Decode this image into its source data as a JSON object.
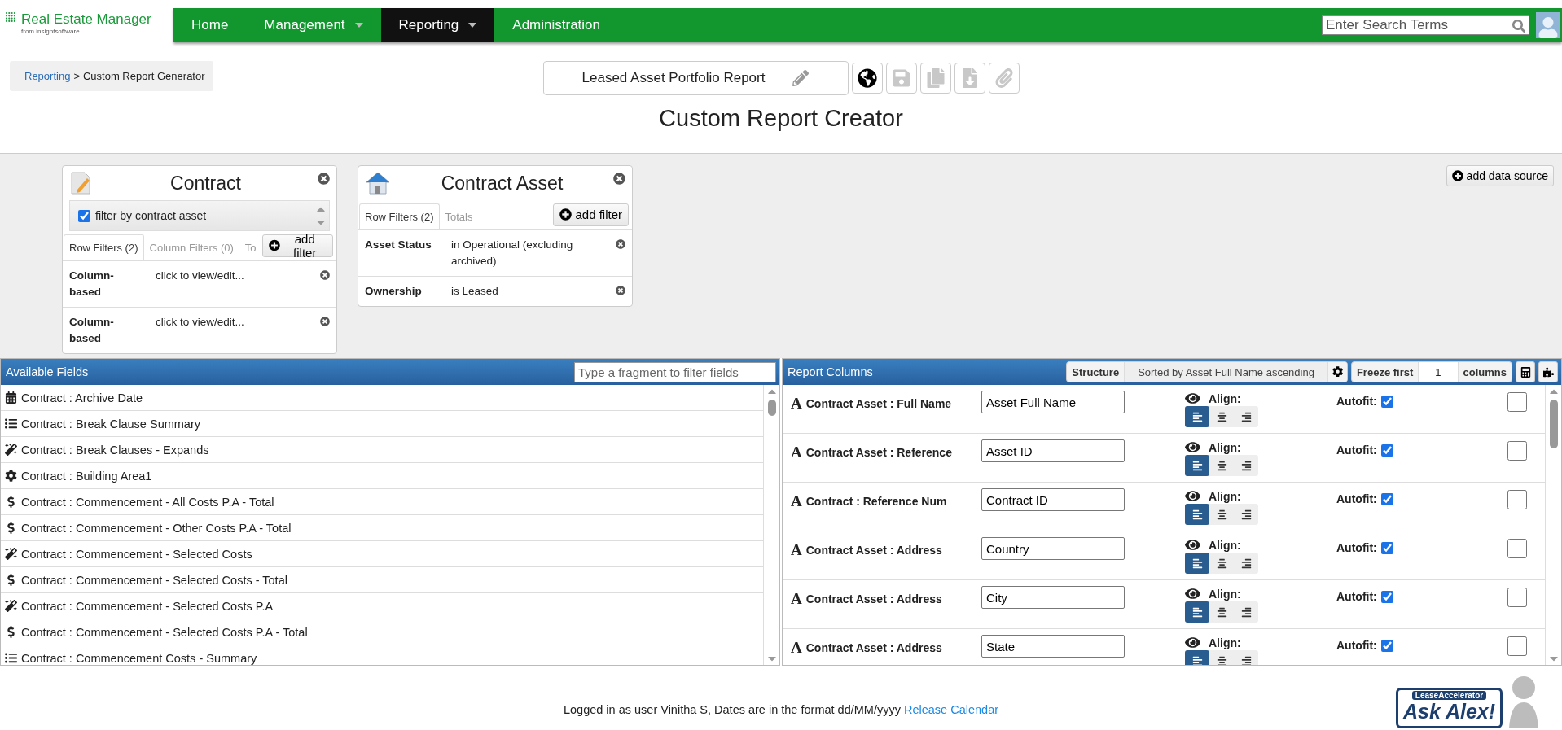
{
  "logo": {
    "title": "Real Estate Manager",
    "subtitle": "from insightsoftware"
  },
  "nav": [
    {
      "label": "Home",
      "selected": false,
      "has_menu": false
    },
    {
      "label": "Management",
      "selected": false,
      "has_menu": true
    },
    {
      "label": "Reporting",
      "selected": true,
      "has_menu": true
    },
    {
      "label": "Administration",
      "selected": false,
      "has_menu": false
    }
  ],
  "search": {
    "placeholder": "Enter Search Terms"
  },
  "breadcrumb": {
    "link": "Reporting",
    "separator": ">",
    "current": "Custom Report Generator"
  },
  "report_name": "Leased Asset Portfolio Report",
  "toolbar": [
    {
      "kind": "globe",
      "disabled": false
    },
    {
      "kind": "save",
      "disabled": true
    },
    {
      "kind": "copy",
      "disabled": true
    },
    {
      "kind": "download",
      "disabled": true
    },
    {
      "kind": "attach",
      "disabled": true
    }
  ],
  "title": "Custom Report Creator",
  "add_data_source": "add data source",
  "sources": [
    {
      "kind": "document",
      "title": "Contract",
      "option": {
        "label": "filter by contract asset",
        "checked": true
      },
      "tabs": [
        {
          "label": "Row Filters (2)",
          "selected": true
        },
        {
          "label": "Column Filters (0)",
          "selected": false
        },
        {
          "label": "To",
          "selected": false
        }
      ],
      "add_filter": "add filter",
      "filters": [
        {
          "field": "Column-based",
          "value": "click to view/edit..."
        },
        {
          "field": "Column-based",
          "value": "click to view/edit..."
        }
      ]
    },
    {
      "kind": "house",
      "title": "Contract Asset",
      "tabs": [
        {
          "label": "Row Filters (2)",
          "selected": true
        },
        {
          "label": "Totals",
          "selected": false
        }
      ],
      "add_filter": "add filter",
      "filters": [
        {
          "field": "Asset Status",
          "value": "in Operational (excluding archived)"
        },
        {
          "field": "Ownership",
          "value": "is Leased"
        }
      ]
    }
  ],
  "available_fields": {
    "title": "Available Fields",
    "placeholder": "Type a fragment to filter fields",
    "items": [
      {
        "kind": "date",
        "label": "Contract : Archive Date"
      },
      {
        "kind": "list",
        "label": "Contract : Break Clause Summary"
      },
      {
        "kind": "calc",
        "label": "Contract : Break Clauses - Expands"
      },
      {
        "kind": "custom",
        "label": "Contract : Building Area1"
      },
      {
        "kind": "money",
        "label": "Contract : Commencement - All Costs P.A - Total"
      },
      {
        "kind": "money",
        "label": "Contract : Commencement - Other Costs P.A - Total"
      },
      {
        "kind": "calc",
        "label": "Contract : Commencement - Selected Costs"
      },
      {
        "kind": "money",
        "label": "Contract : Commencement - Selected Costs - Total"
      },
      {
        "kind": "calc",
        "label": "Contract : Commencement - Selected Costs P.A"
      },
      {
        "kind": "money",
        "label": "Contract : Commencement - Selected Costs P.A - Total"
      },
      {
        "kind": "list",
        "label": "Contract : Commencement Costs - Summary"
      }
    ]
  },
  "report_columns": {
    "title": "Report Columns",
    "structure_label": "Structure",
    "structure_value": "Sorted by Asset Full Name ascending",
    "freeze_label": "Freeze first",
    "freeze_value": "1",
    "freeze_unit": "columns",
    "rows": [
      {
        "type_icon": "A",
        "field": "Contract Asset : Full Name",
        "heading": "Asset Full Name",
        "visible": true,
        "align_label": "Align:",
        "align": [
          {
            "selected": true
          },
          {
            "selected": false
          },
          {
            "selected": false
          }
        ],
        "autofit_label": "Autofit:",
        "autofit": true,
        "checked": false
      },
      {
        "type_icon": "A",
        "field": "Contract Asset : Reference",
        "heading": "Asset ID",
        "visible": true,
        "align_label": "Align:",
        "align": [
          {
            "selected": true
          },
          {
            "selected": false
          },
          {
            "selected": false
          }
        ],
        "autofit_label": "Autofit:",
        "autofit": true,
        "checked": false
      },
      {
        "type_icon": "A",
        "field": "Contract : Reference Num",
        "heading": "Contract ID",
        "visible": true,
        "align_label": "Align:",
        "align": [
          {
            "selected": true
          },
          {
            "selected": false
          },
          {
            "selected": false
          }
        ],
        "autofit_label": "Autofit:",
        "autofit": true,
        "checked": false
      },
      {
        "type_icon": "A",
        "field": "Contract Asset : Address",
        "heading": "Country",
        "visible": true,
        "align_label": "Align:",
        "align": [
          {
            "selected": true
          },
          {
            "selected": false
          },
          {
            "selected": false
          }
        ],
        "autofit_label": "Autofit:",
        "autofit": true,
        "checked": false
      },
      {
        "type_icon": "A",
        "field": "Contract Asset : Address",
        "heading": "City",
        "visible": true,
        "align_label": "Align:",
        "align": [
          {
            "selected": true
          },
          {
            "selected": false
          },
          {
            "selected": false
          }
        ],
        "autofit_label": "Autofit:",
        "autofit": true,
        "checked": false
      },
      {
        "type_icon": "A",
        "field": "Contract Asset : Address",
        "heading": "State",
        "visible": true,
        "align_label": "Align:",
        "align": [
          {
            "selected": true
          },
          {
            "selected": false
          },
          {
            "selected": false
          }
        ],
        "autofit_label": "Autofit:",
        "autofit": true,
        "checked": false
      }
    ]
  },
  "footer": {
    "text": "Logged in as user Vinitha S, Dates are in the format dd/MM/yyyy",
    "link": "Release Calendar"
  },
  "helper": {
    "brand": "LeaseAccelerator",
    "label": "Ask Alex!"
  }
}
